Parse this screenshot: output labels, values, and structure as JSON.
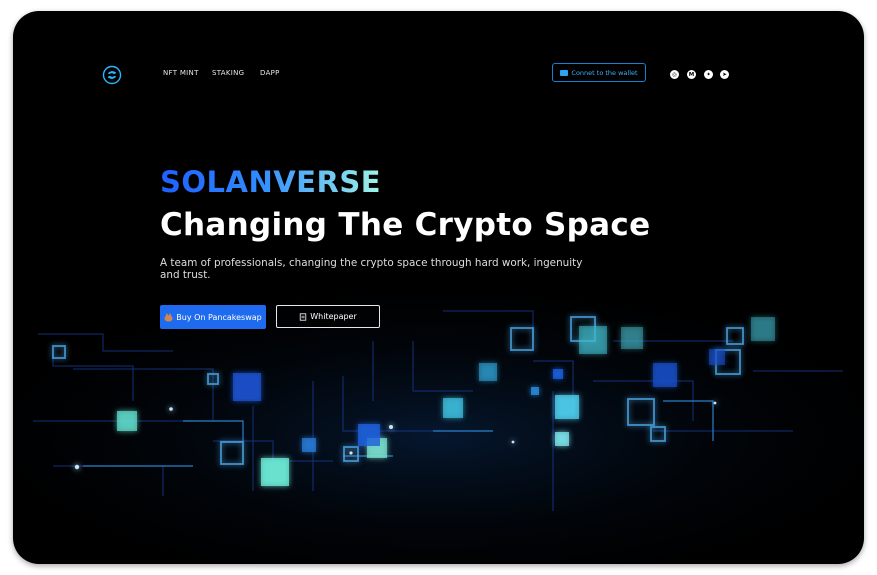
{
  "nav": {
    "links": [
      "NFT MINT",
      "STAKING",
      "DAPP"
    ],
    "connect_label": "Connet to the wallet",
    "socials": [
      {
        "icon": "instagram-icon",
        "glyph": "◎"
      },
      {
        "icon": "medium-icon",
        "glyph": "M"
      },
      {
        "icon": "twitter-icon",
        "glyph": "✦"
      },
      {
        "icon": "telegram-icon",
        "glyph": "➤"
      }
    ]
  },
  "hero": {
    "brand": "SOLANVERSE",
    "headline": "Changing The Crypto Space",
    "subtitle": "A team of professionals, changing the crypto space through hard work, ingenuity and trust.",
    "buy_label": "Buy On Pancakeswap",
    "whitepaper_label": "Whitepaper"
  },
  "colors": {
    "background": "#000000",
    "accent": "#1f6bf0",
    "connect_border": "#1a7fd0",
    "glow_teal": "#5fe0d0"
  }
}
